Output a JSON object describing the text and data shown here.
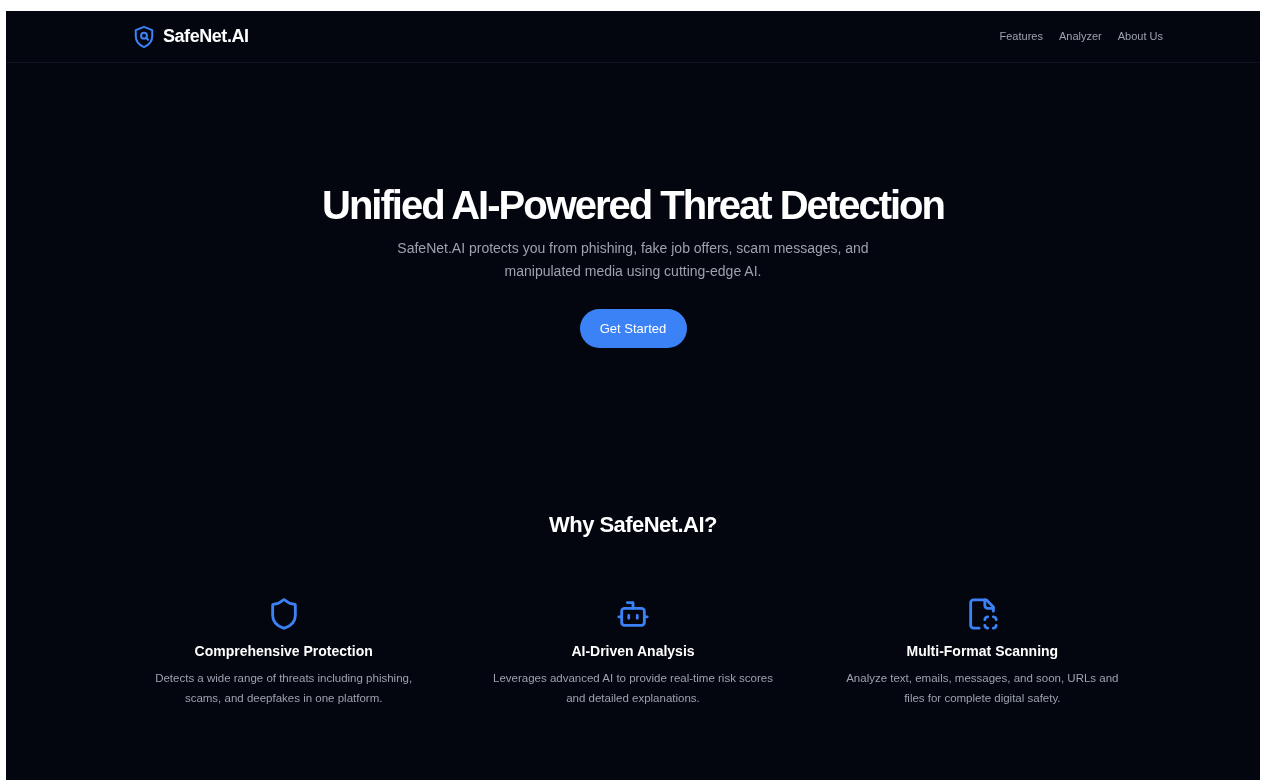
{
  "header": {
    "brand": "SafeNet.AI",
    "nav": [
      {
        "label": "Features"
      },
      {
        "label": "Analyzer"
      },
      {
        "label": "About Us"
      }
    ]
  },
  "hero": {
    "title": "Unified AI-Powered Threat Detection",
    "subtitle": "SafeNet.AI protects you from phishing, fake job offers, scam messages, and manipulated media using cutting-edge AI.",
    "button": "Get Started"
  },
  "features": {
    "heading": "Why SafeNet.AI?",
    "items": [
      {
        "kind": "shield",
        "title": "Comprehensive Protection",
        "description": "Detects a wide range of threats including phishing, scams, and deepfakes in one platform."
      },
      {
        "kind": "bot",
        "title": "AI-Driven Analysis",
        "description": "Leverages advanced AI to provide real-time risk scores and detailed explanations."
      },
      {
        "kind": "file",
        "title": "Multi-Format Scanning",
        "description": "Analyze text, emails, messages, and soon, URLs and files for complete digital safety."
      }
    ]
  }
}
